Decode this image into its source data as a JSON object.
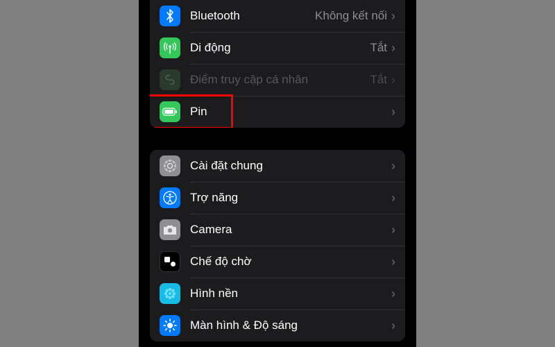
{
  "group1": {
    "items": [
      {
        "label": "Bluetooth",
        "value": "Không kết nối",
        "icon_bg": "#007aff"
      },
      {
        "label": "Di động",
        "value": "Tắt",
        "icon_bg": "#34c759"
      },
      {
        "label": "Điểm truy cập cá nhân",
        "value": "Tắt",
        "icon_bg": "#2a3a2f",
        "disabled": true
      },
      {
        "label": "Pin",
        "value": "",
        "icon_bg": "#34c759",
        "highlight": true
      }
    ]
  },
  "group2": {
    "items": [
      {
        "label": "Cài đặt chung",
        "value": "",
        "icon_bg": "#8e8e93"
      },
      {
        "label": "Trợ năng",
        "value": "",
        "icon_bg": "#007aff"
      },
      {
        "label": "Camera",
        "value": "",
        "icon_bg": "#8e8e93"
      },
      {
        "label": "Chế độ chờ",
        "value": "",
        "icon_bg": "#000000"
      },
      {
        "label": "Hình nền",
        "value": "",
        "icon_bg": "#17bce4"
      },
      {
        "label": "Màn hình & Độ sáng",
        "value": "",
        "icon_bg": "#007aff"
      }
    ]
  }
}
